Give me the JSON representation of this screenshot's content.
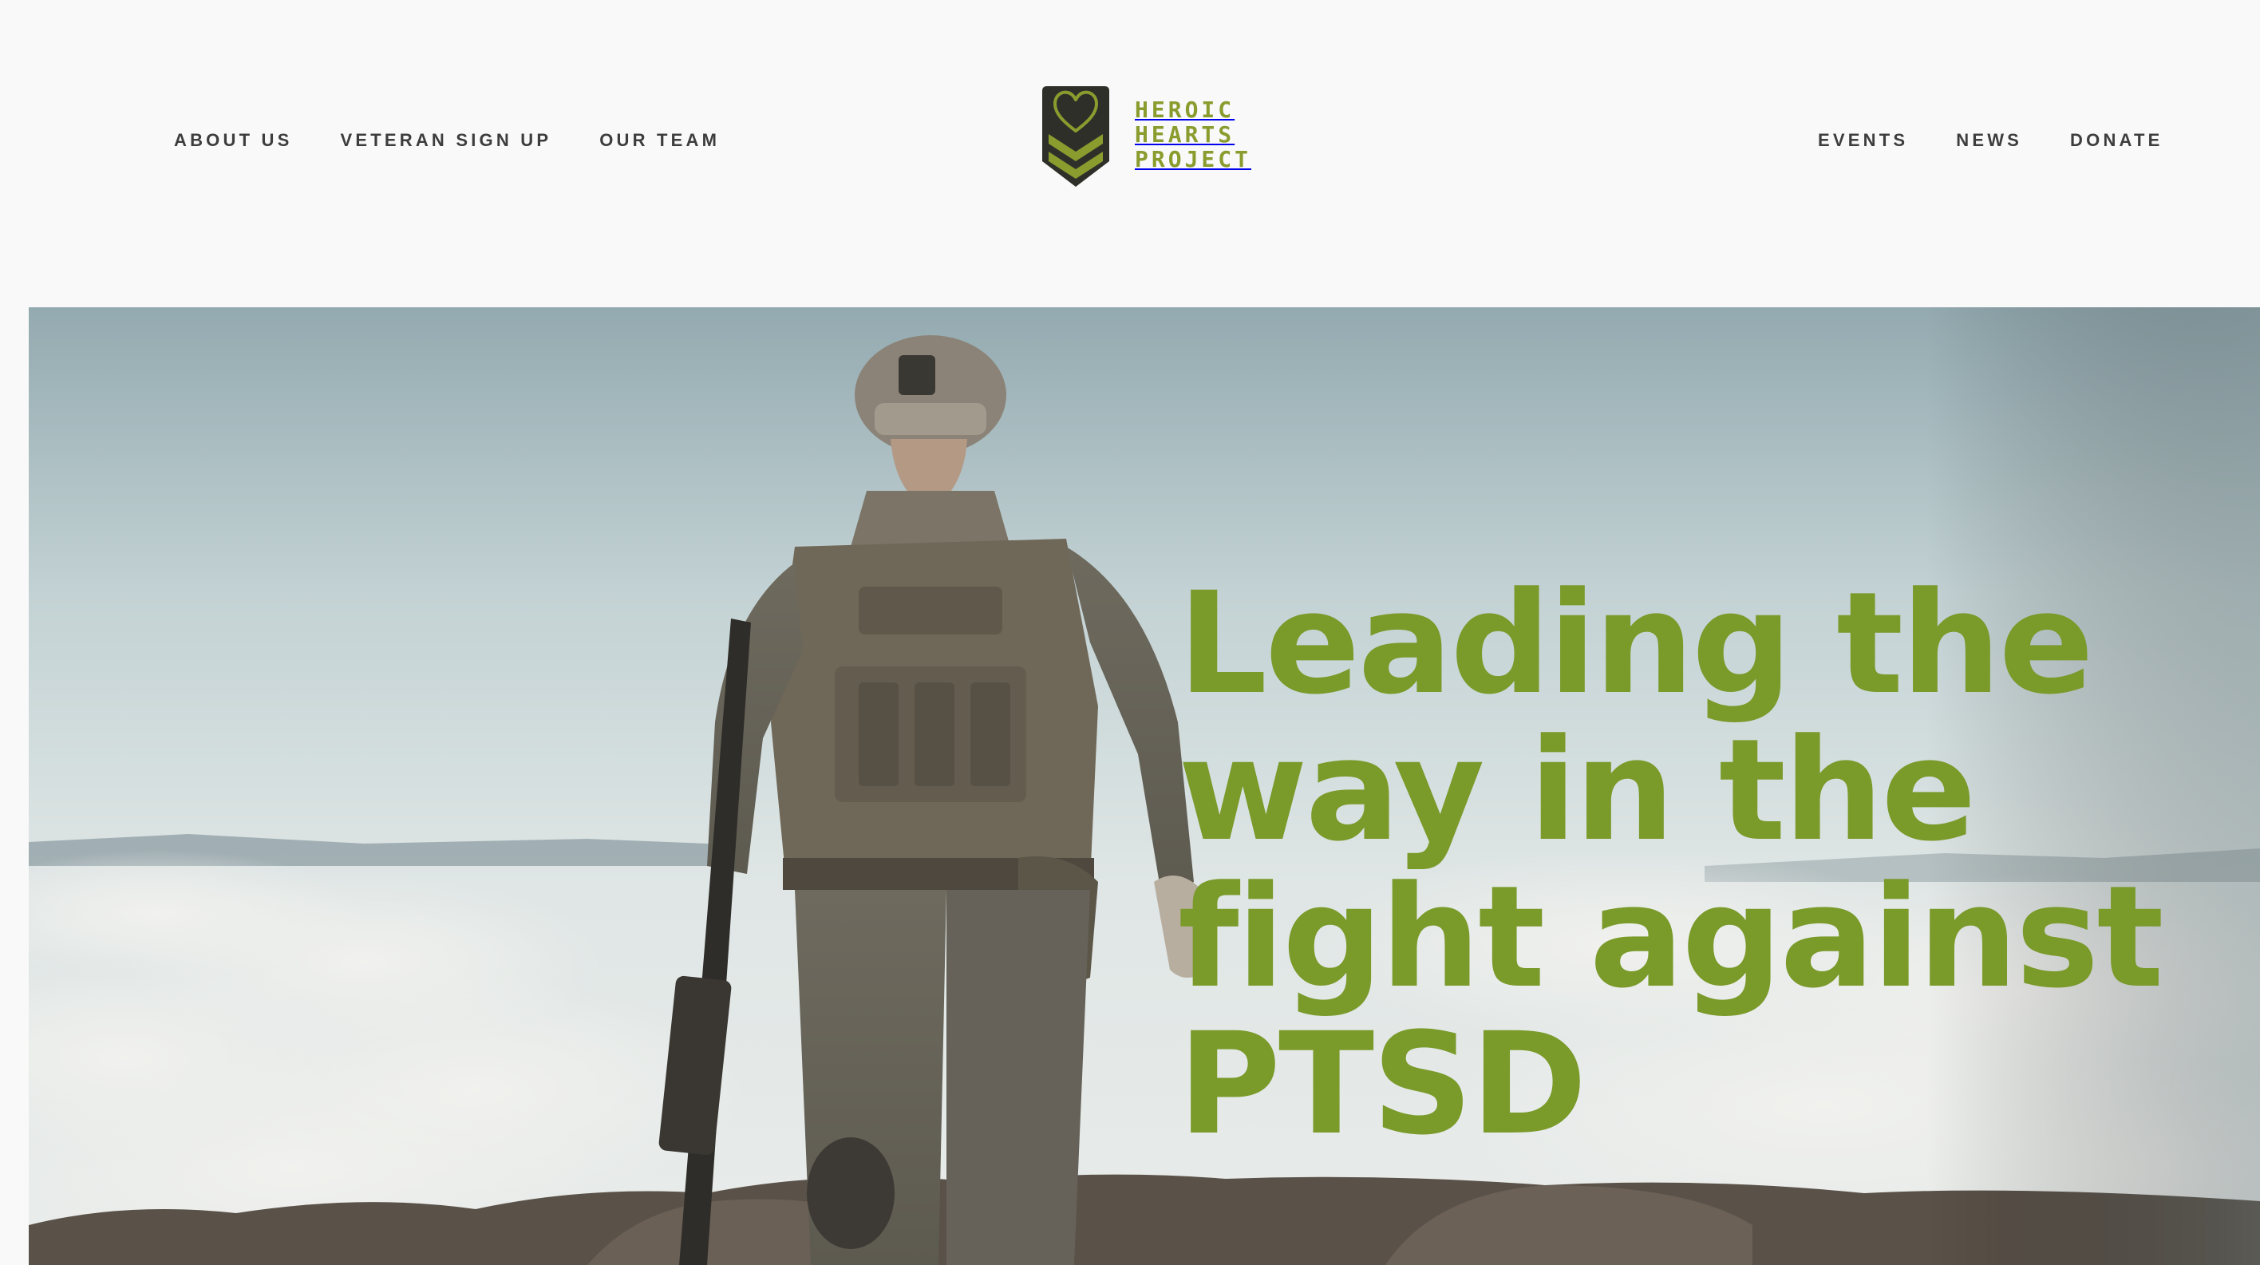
{
  "header": {
    "nav_left": [
      "ABOUT US",
      "VETERAN SIGN UP",
      "OUR TEAM"
    ],
    "nav_right": [
      "EVENTS",
      "NEWS",
      "DONATE"
    ],
    "logo": {
      "lines": [
        "HEROIC",
        "HEARTS",
        "PROJECT"
      ]
    }
  },
  "hero": {
    "headline_lines": [
      "Leading the",
      "way in the",
      "fight against",
      "PTSD"
    ]
  },
  "colors": {
    "brand_green": "#7a9a2a",
    "logo_green": "#8a9c2e",
    "badge_dark": "#2f2f2a",
    "nav_text": "#3d3d3d",
    "background": "#f9f9f9"
  },
  "icons": [
    "heart-chevron-badge-icon"
  ]
}
